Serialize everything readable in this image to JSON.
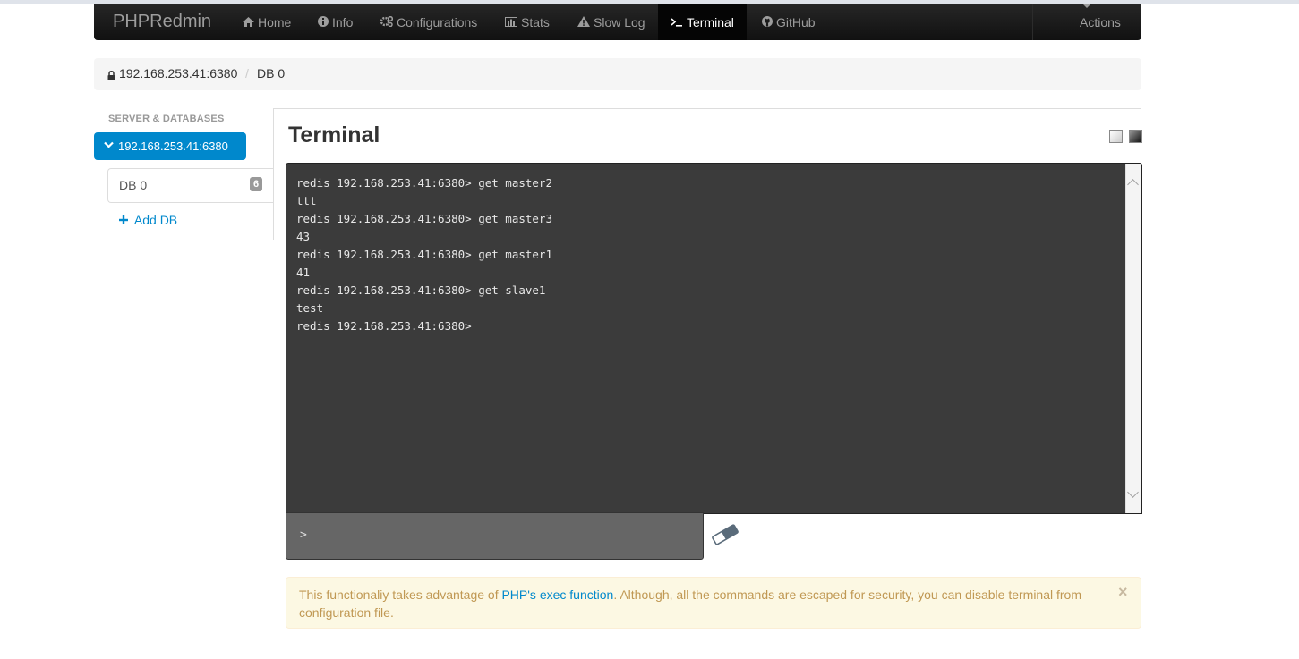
{
  "navbar": {
    "brand": "PHPRedmin",
    "items": [
      {
        "label": "Home",
        "icon": "home-icon"
      },
      {
        "label": "Info",
        "icon": "info-icon"
      },
      {
        "label": "Configurations",
        "icon": "cogs-icon"
      },
      {
        "label": "Stats",
        "icon": "bar-chart-icon"
      },
      {
        "label": "Slow Log",
        "icon": "warning-icon"
      },
      {
        "label": "Terminal",
        "icon": "terminal-icon",
        "active": true
      },
      {
        "label": "GitHub",
        "icon": "github-icon"
      }
    ],
    "actions_label": "Actions"
  },
  "breadcrumb": {
    "server": "192.168.253.41:6380",
    "separator": "/",
    "db": "DB 0"
  },
  "sidebar": {
    "header": "SERVER & DATABASES",
    "server": "192.168.253.41:6380",
    "db_label": "DB 0",
    "db_badge": "6",
    "add_db": "Add DB"
  },
  "terminal": {
    "title": "Terminal",
    "lines": [
      "redis 192.168.253.41:6380> get master2",
      "ttt",
      "redis 192.168.253.41:6380> get master3",
      "43",
      "redis 192.168.253.41:6380> get master1",
      "41",
      "redis 192.168.253.41:6380> get slave1",
      "test",
      "redis 192.168.253.41:6380>"
    ],
    "input_prompt": ">"
  },
  "alert": {
    "text_before": "This functionaliy takes advantage of ",
    "link": "PHP's exec function",
    "text_after": ". Although, all the commands are escaped for security, you can disable terminal from configuration file.",
    "close": "×"
  },
  "colors": {
    "navbar": "#1b1b1b",
    "accent": "#0088cc",
    "terminal_bg": "#3b3b3b",
    "alert_bg": "#fcf8e3",
    "alert_text": "#c09853"
  }
}
